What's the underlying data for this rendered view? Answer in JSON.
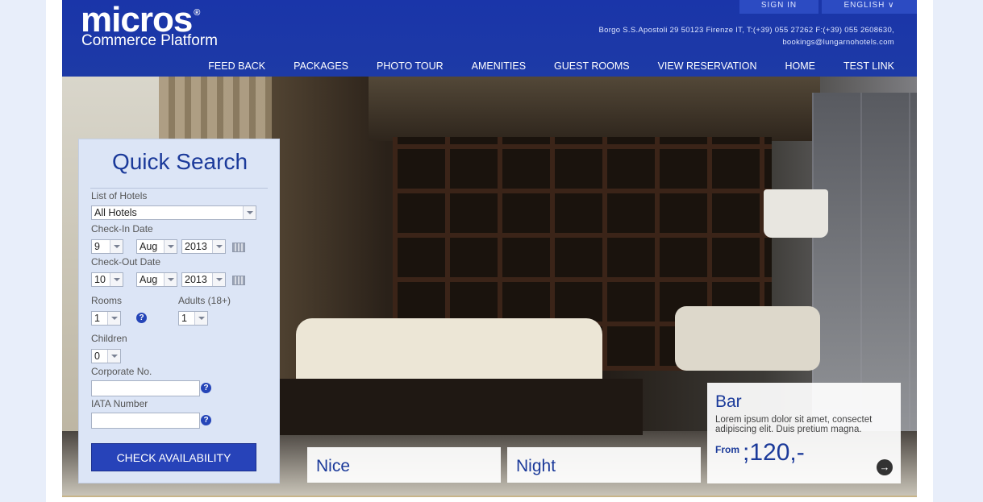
{
  "header": {
    "logo": "micros",
    "logo_mark": "®",
    "logo_sub": "Commerce Platform",
    "sign_in": "SIGN IN",
    "language": "ENGLISH ∨",
    "address_line1": "Borgo S.S.Apostoli 29 50123 Firenze IT, T:(+39) 055 27262 F:(+39) 055 2608630,",
    "address_line2": "bookings@lungarnohotels.com"
  },
  "nav": [
    "FEED BACK",
    "PACKAGES",
    "PHOTO TOUR",
    "AMENITIES",
    "GUEST ROOMS",
    "VIEW RESERVATION",
    "HOME",
    "TEST LINK"
  ],
  "quick_search": {
    "title": "Quick Search",
    "hotels_label": "List of Hotels",
    "hotels_value": "All Hotels",
    "checkin_label": "Check-In Date",
    "checkin_day": "9",
    "checkin_month": "Aug",
    "checkin_year": "2013",
    "checkout_label": "Check-Out Date",
    "checkout_day": "10",
    "checkout_month": "Aug",
    "checkout_year": "2013",
    "rooms_label": "Rooms",
    "rooms_value": "1",
    "adults_label": "Adults (18+)",
    "adults_value": "1",
    "children_label": "Children",
    "children_value": "0",
    "corporate_label": "Corporate No.",
    "iata_label": "IATA Number",
    "help_glyph": "?",
    "button": "CHECK AVAILABILITY"
  },
  "cards": {
    "nice": "Nice",
    "night": "Night",
    "bar_title": "Bar",
    "bar_desc": "Lorem ipsum dolor sit amet, consectet adipiscing elit. Duis pretium magna.",
    "bar_from": "From",
    "bar_price": ";120,-",
    "arrow": "→"
  },
  "colors": {
    "header_blue": "#1b36a8",
    "panel_bg": "#dce5f6",
    "button_blue": "#2743b9"
  }
}
